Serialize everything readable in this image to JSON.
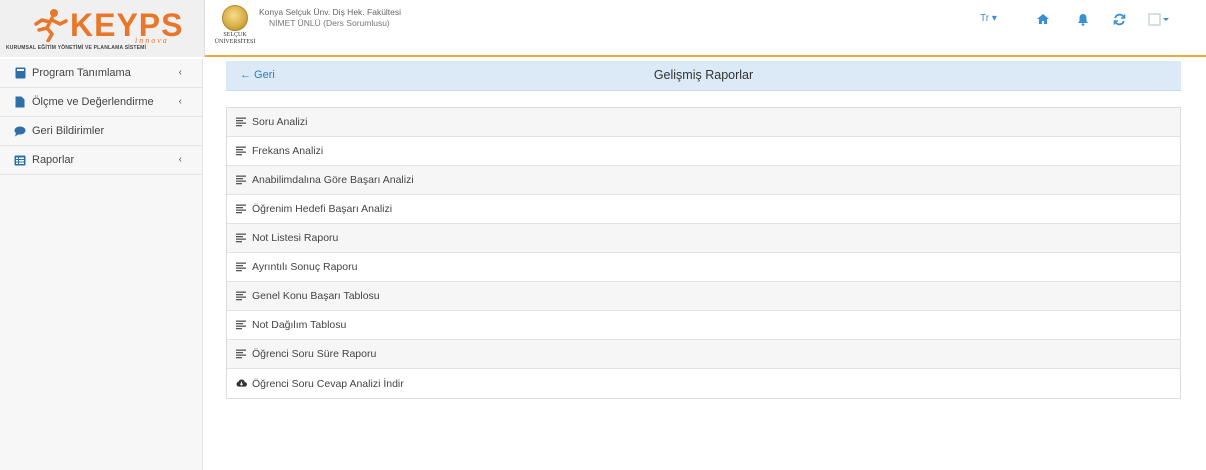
{
  "brand": {
    "logo_text": "KEYPS",
    "logo_tagline": "innova",
    "logo_subtitle": "KURUMSAL EĞİTİM YÖNETİMİ VE PLANLAMA SİSTEMİ",
    "university_name": "SELÇUK ÜNİVERSİTESİ",
    "accent_color": "#e8772b"
  },
  "header": {
    "faculty": "Konya Selçuk Ünv. Diş Hek. Fakültesi",
    "user": "NİMET ÜNLÜ (Ders Sorumlusu)",
    "lang_label": "Tr ▾",
    "icons": [
      "home-icon",
      "bell-icon",
      "refresh-icon",
      "user-menu-icon"
    ],
    "nav_color": "#3a8fd4"
  },
  "sidebar": {
    "items": [
      {
        "label": "Program Tanımlama",
        "icon": "book-icon",
        "has_children": true
      },
      {
        "label": "Ölçme ve Değerlendirme",
        "icon": "file-icon",
        "has_children": true
      },
      {
        "label": "Geri Bildirimler",
        "icon": "comment-icon",
        "has_children": false
      },
      {
        "label": "Raporlar",
        "icon": "list-icon",
        "has_children": true
      }
    ]
  },
  "main": {
    "back_label": "← Geri",
    "title": "Gelişmiş Raporlar",
    "reports": [
      {
        "label": "Soru Analizi",
        "icon": "align-left-icon"
      },
      {
        "label": "Frekans Analizi",
        "icon": "align-left-icon"
      },
      {
        "label": "Anabilimdalına Göre Başarı Analizi",
        "icon": "align-left-icon"
      },
      {
        "label": "Öğrenim Hedefi Başarı Analizi",
        "icon": "align-left-icon"
      },
      {
        "label": "Not Listesi Raporu",
        "icon": "align-left-icon"
      },
      {
        "label": "Ayrıntılı Sonuç Raporu",
        "icon": "align-left-icon"
      },
      {
        "label": "Genel Konu Başarı Tablosu",
        "icon": "align-left-icon"
      },
      {
        "label": "Not Dağılım Tablosu",
        "icon": "align-left-icon"
      },
      {
        "label": "Öğrenci Soru Süre Raporu",
        "icon": "align-left-icon"
      },
      {
        "label": "Öğrenci Soru Cevap Analizi İndir",
        "icon": "cloud-download-icon"
      }
    ]
  }
}
